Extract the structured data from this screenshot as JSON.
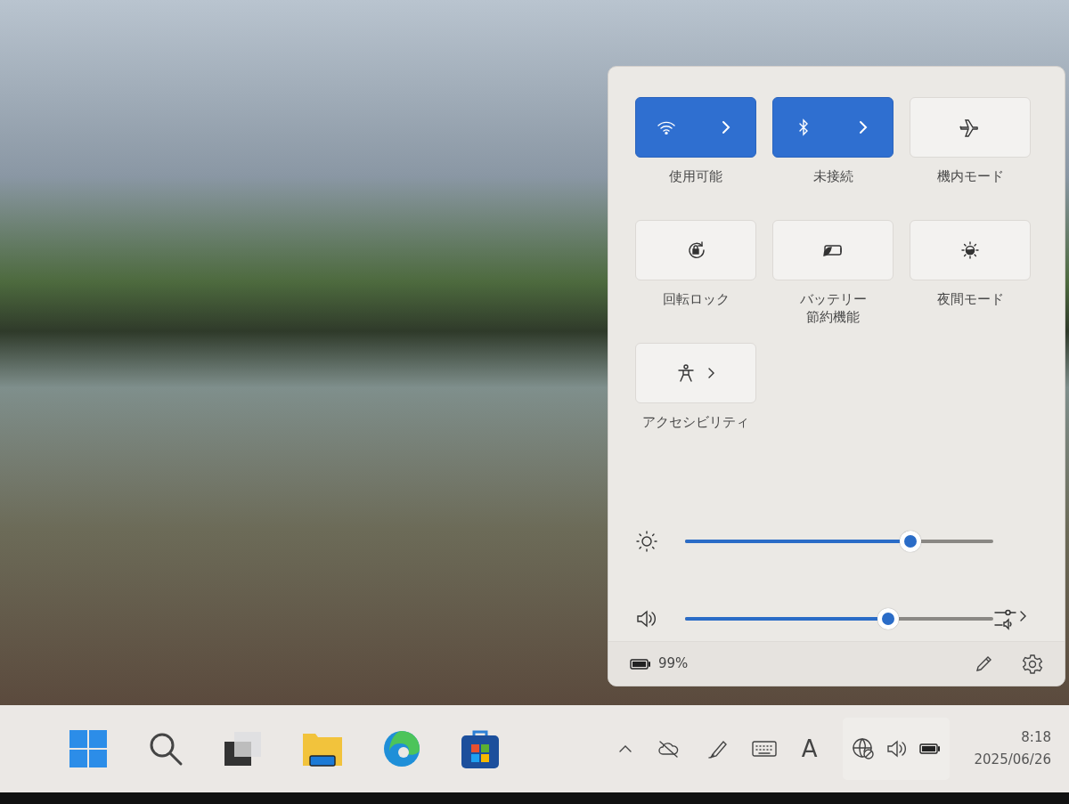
{
  "quick_settings": {
    "tiles": [
      {
        "kind": "split",
        "label": "使用可能",
        "on": true
      },
      {
        "kind": "split",
        "label": "未接続",
        "on": true
      },
      {
        "kind": "plain",
        "label": "機内モード",
        "on": false
      },
      {
        "kind": "plain",
        "label": "回転ロック",
        "on": false
      },
      {
        "kind": "plain",
        "label_lines": [
          "バッテリー",
          "節約機能"
        ],
        "on": false
      },
      {
        "kind": "plain",
        "label": "夜間モード",
        "on": false
      },
      {
        "kind": "chevron",
        "label": "アクセシビリティ",
        "on": false
      }
    ],
    "sliders": [
      {
        "kind": "brightness",
        "level": 0.73
      },
      {
        "kind": "volume",
        "level": 0.66
      }
    ],
    "battery": "99%"
  },
  "taskbar": {
    "ime": "A",
    "time": "8:18",
    "date": "2025/06/26"
  }
}
